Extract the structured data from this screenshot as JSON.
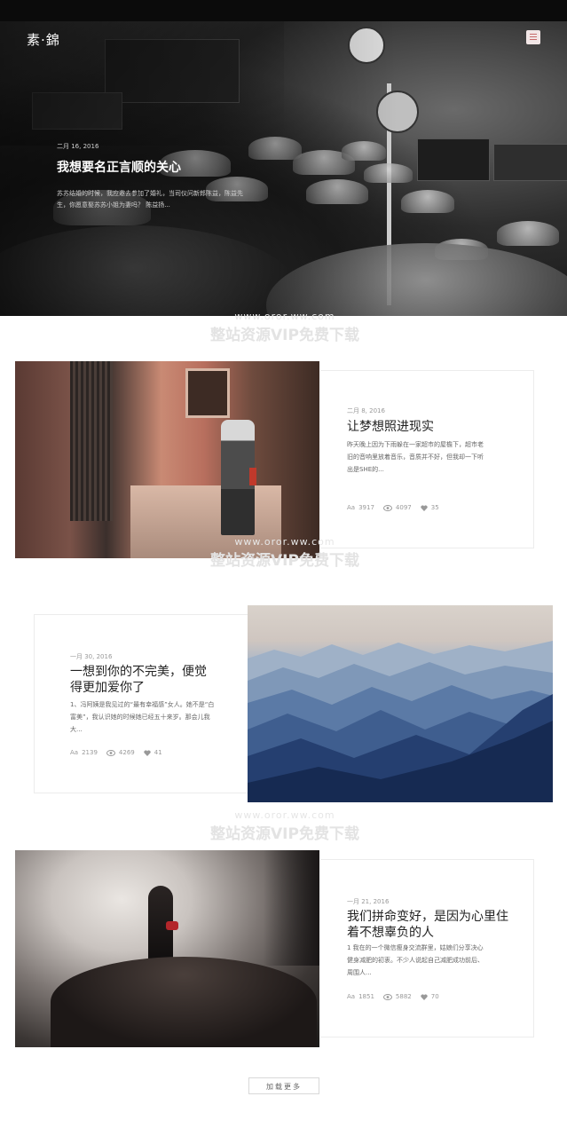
{
  "header": {
    "logo": "素·錦",
    "menu_icon": "menu-icon"
  },
  "hero": {
    "date": "二月 16, 2016",
    "title": "我想要名正言顺的关心",
    "excerpt": "苏苏结婚的时候，我应邀去参加了婚礼，当司仪问新郎陈益，陈益先生，你愿意娶苏苏小姐为妻吗？ 陈益扬..."
  },
  "watermark": {
    "url": "www.oror.ww.com",
    "text": "整站资源VIP免费下载"
  },
  "posts": [
    {
      "date": "二月 8, 2016",
      "title": "让梦想照进现实",
      "excerpt": "昨天晚上因为下雨躲在一家超市的屋檐下，超市老旧的音响里放着音乐，音质并不好，但我却一下听出是SHE的...",
      "views": "3917",
      "comments": "4097",
      "likes": "35",
      "image": "alley-photo"
    },
    {
      "date": "一月 30, 2016",
      "title": "一想到你的不完美，便觉得更加爱你了",
      "excerpt": "1、冯阿姨是我见过的“最有幸福感”女人。她不是“白富美”，我认识她的时候她已经五十来岁。那会儿我大...",
      "views": "2139",
      "comments": "4269",
      "likes": "41",
      "image": "mountains-photo"
    },
    {
      "date": "一月 21, 2016",
      "title": "我们拼命变好，是因为心里住着不想辜负的人",
      "excerpt": "1 我在的一个微信瘦身交流群里，姑娘们分享决心健身减肥的初衷。不少人说起自己减肥成功前后、周围人...",
      "views": "1851",
      "comments": "5882",
      "likes": "70",
      "image": "dark-fantasy-photo"
    }
  ],
  "load_more": "加载更多",
  "icons": {
    "views": "font-icon",
    "comments": "eye-icon",
    "likes": "heart-icon"
  }
}
